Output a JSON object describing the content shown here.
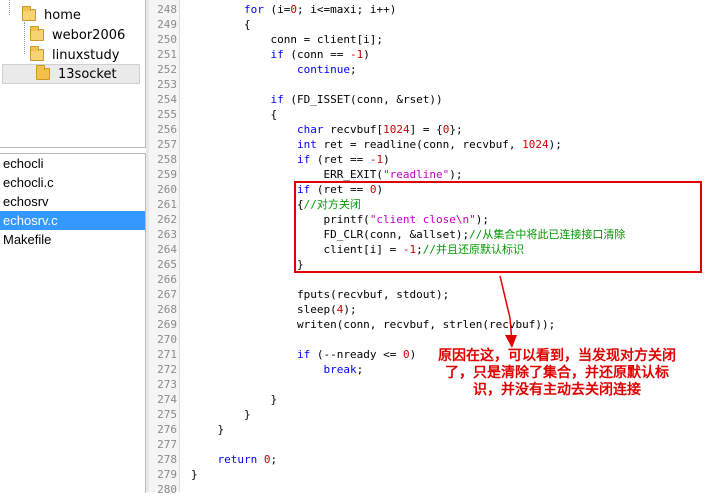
{
  "tree": {
    "items": [
      {
        "label": "home"
      },
      {
        "label": "webor2006"
      },
      {
        "label": "linuxstudy"
      },
      {
        "label": "13socket"
      }
    ]
  },
  "files": {
    "items": [
      "echocli",
      "echocli.c",
      "echosrv",
      "echosrv.c",
      "Makefile"
    ],
    "selected": "echosrv.c"
  },
  "code": {
    "lines": [
      {
        "n": "248",
        "t": "        for (i=0; i<=maxi; i++)"
      },
      {
        "n": "249",
        "t": "        {"
      },
      {
        "n": "250",
        "t": "            conn = client[i];"
      },
      {
        "n": "251",
        "t": "            if (conn == -1)"
      },
      {
        "n": "252",
        "t": "                continue;"
      },
      {
        "n": "253",
        "t": ""
      },
      {
        "n": "254",
        "t": "            if (FD_ISSET(conn, &rset))"
      },
      {
        "n": "255",
        "t": "            {"
      },
      {
        "n": "256",
        "t": "                char recvbuf[1024] = {0};"
      },
      {
        "n": "257",
        "t": "                int ret = readline(conn, recvbuf, 1024);"
      },
      {
        "n": "258",
        "t": "                if (ret == -1)"
      },
      {
        "n": "259",
        "t": "                    ERR_EXIT(\"readline\");"
      },
      {
        "n": "260",
        "t": "                if (ret == 0)"
      },
      {
        "n": "261",
        "t": "                {//对方关闭"
      },
      {
        "n": "262",
        "t": "                    printf(\"client close\\n\");"
      },
      {
        "n": "263",
        "t": "                    FD_CLR(conn, &allset);//从集合中将此已连接接口清除"
      },
      {
        "n": "264",
        "t": "                    client[i] = -1;//并且还原默认标识"
      },
      {
        "n": "265",
        "t": "                }"
      },
      {
        "n": "266",
        "t": ""
      },
      {
        "n": "267",
        "t": "                fputs(recvbuf, stdout);"
      },
      {
        "n": "268",
        "t": "                sleep(4);"
      },
      {
        "n": "269",
        "t": "                writen(conn, recvbuf, strlen(recvbuf));"
      },
      {
        "n": "270",
        "t": ""
      },
      {
        "n": "271",
        "t": "                if (--nready <= 0)"
      },
      {
        "n": "272",
        "t": "                    break;"
      },
      {
        "n": "273",
        "t": ""
      },
      {
        "n": "274",
        "t": "            }"
      },
      {
        "n": "275",
        "t": "        }"
      },
      {
        "n": "276",
        "t": "    }"
      },
      {
        "n": "277",
        "t": ""
      },
      {
        "n": "278",
        "t": "    return 0;"
      },
      {
        "n": "279",
        "t": "}"
      },
      {
        "n": "280",
        "t": ""
      }
    ]
  },
  "annotation": {
    "text": "原因在这，可以看到，当发现对方关闭了，只是清除了集合，并还原默认标识，并没有主动去关闭连接",
    "color": "#e00000"
  },
  "colors": {
    "selection": "#3399ff",
    "keyword": "#0000ff",
    "string": "#c000c0",
    "number": "#cc0000",
    "comment": "#009900"
  }
}
